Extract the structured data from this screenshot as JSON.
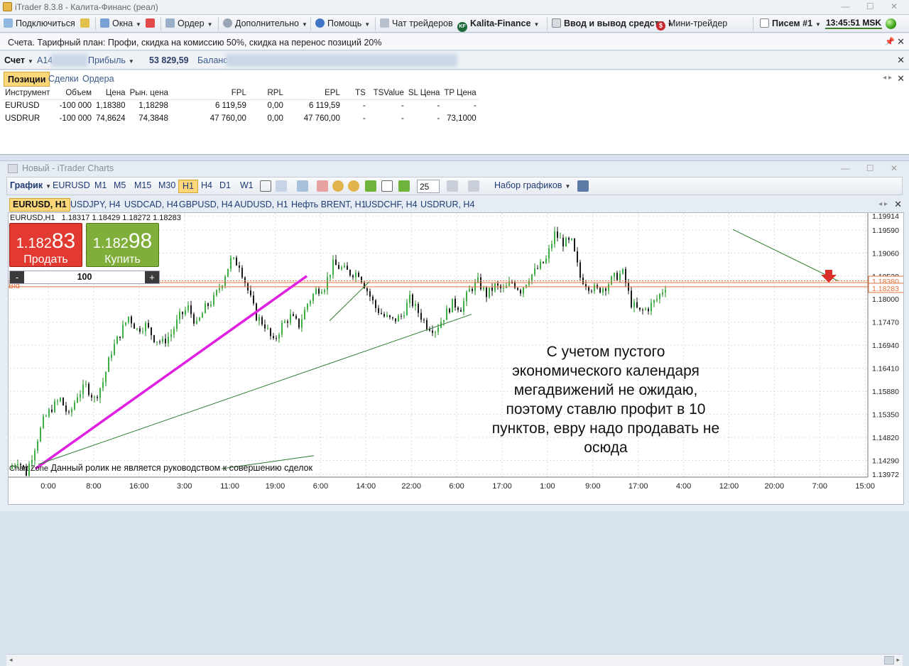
{
  "window": {
    "title": "iTrader 8.3.8 - Калита-Финанс (реал)",
    "controls": "—  ☐  ✕"
  },
  "menu": {
    "connect": "Подключиться",
    "windows": "Окна",
    "order": "Ордер",
    "extra": "Дополнительно",
    "help": "Помощь",
    "chat": "Чат трейдеров",
    "kf_badge": "KF",
    "kf": "Kalita-Finance",
    "deposit": "Ввод и вывод средств",
    "mini_badge": "$",
    "mini": "Мини-трейдер",
    "letters": "Писем #1",
    "clock": "13:45:51 MSK"
  },
  "infobar": {
    "text": "Счета. Тарифный план: Профи, скидка на комиссию 50%, скидка на перенос позиций 20%"
  },
  "account": {
    "account_label": "Счет",
    "account_value": "A14",
    "profit_label": "Прибыль",
    "profit_value": "53 829,59",
    "balance_label": "Баланс"
  },
  "positions": {
    "tabs": [
      "Позиции",
      "Сделки",
      "Ордера"
    ],
    "headers": [
      "Инструмент",
      "Объем",
      "Цена",
      "Рын. цена",
      "FPL",
      "RPL",
      "EPL",
      "TS",
      "TSValue",
      "SL Цена",
      "TP Цена"
    ],
    "rows": [
      [
        "EURUSD",
        "-100 000",
        "1,18380",
        "1,18298",
        "6 119,59",
        "0,00",
        "6 119,59",
        "-",
        "-",
        "-",
        "-"
      ],
      [
        "USDRUR",
        "-100 000",
        "74,8624",
        "74,3848",
        "47 760,00",
        "0,00",
        "47 760,00",
        "-",
        "-",
        "-",
        "73,1000"
      ]
    ]
  },
  "chartwin": {
    "title": "Новый - iTrader Charts"
  },
  "toolbar": {
    "chart": "График",
    "symbol": "EURUSD",
    "timeframes": [
      "M1",
      "M5",
      "M15",
      "M30",
      "H1",
      "H4",
      "D1",
      "W1"
    ],
    "active_tf": "H1",
    "spin": "25",
    "chart_set": "Набор графиков"
  },
  "symbol_tabs": [
    "EURUSD, H1",
    "USDJPY, H4",
    "USDCAD, H4",
    "GBPUSD, H4",
    "AUDUSD, H1",
    "Нефть BRENT, H1",
    "USDCHF, H4",
    "USDRUR, H4"
  ],
  "chart_header": {
    "symbol": "EURUSD,H1",
    "values": "1.18317   1.18429   1.18272   1.18283"
  },
  "trade": {
    "sell_price_small": "1.182",
    "sell_price_big": "83",
    "sell_label": "Продать",
    "buy_price_small": "1.182",
    "buy_price_big": "98",
    "buy_label": "Купить",
    "minus": "-",
    "plus": "+",
    "qty": "100"
  },
  "annotation": {
    "lines": [
      "С учетом пустого",
      "экономического календаря",
      "мегадвижений не ожидаю,",
      "поэтому ставлю профит в 10",
      "пунктов, евру надо продавать не",
      "осюда"
    ]
  },
  "footer": {
    "brand": "Chart Zone",
    "text": "Данный ролик не является руководством к совершению сделок"
  },
  "chart_data": {
    "type": "candlestick",
    "symbol": "EURUSD",
    "timeframe": "H1",
    "ylim": [
      1.13972,
      1.19914
    ],
    "y_ticks": [
      "1.19914",
      "1.19590",
      "1.19060",
      "1.18530",
      "1.18000",
      "1.17470",
      "1.16940",
      "1.16410",
      "1.15880",
      "1.15350",
      "1.14820",
      "1.14290",
      "1.13972"
    ],
    "x_ticks": [
      "0:00",
      "8:00",
      "16:00",
      "3:00",
      "11:00",
      "19:00",
      "6:00",
      "14:00",
      "22:00",
      "6:00",
      "17:00",
      "1:00",
      "9:00",
      "17:00",
      "4:00",
      "12:00",
      "20:00",
      "7:00",
      "15:00"
    ],
    "bid_label": "Bid",
    "price_labels": [
      "1.18380",
      "1.18283"
    ],
    "close_path": [
      1.141,
      1.143,
      1.14,
      1.146,
      1.152,
      1.155,
      1.157,
      1.153,
      1.158,
      1.16,
      1.157,
      1.161,
      1.168,
      1.172,
      1.176,
      1.173,
      1.174,
      1.171,
      1.17,
      1.172,
      1.176,
      1.178,
      1.174,
      1.178,
      1.18,
      1.184,
      1.189,
      1.188,
      1.182,
      1.176,
      1.174,
      1.17,
      1.174,
      1.176,
      1.174,
      1.179,
      1.182,
      1.183,
      1.188,
      1.187,
      1.186,
      1.186,
      1.182,
      1.178,
      1.176,
      1.175,
      1.176,
      1.18,
      1.177,
      1.174,
      1.173,
      1.176,
      1.179,
      1.178,
      1.182,
      1.184,
      1.181,
      1.183,
      1.182,
      1.184,
      1.182,
      1.185,
      1.187,
      1.189,
      1.195,
      1.193,
      1.193,
      1.185,
      1.183,
      1.182,
      1.183,
      1.185,
      1.186,
      1.179,
      1.177,
      1.178,
      1.18,
      1.183
    ]
  }
}
